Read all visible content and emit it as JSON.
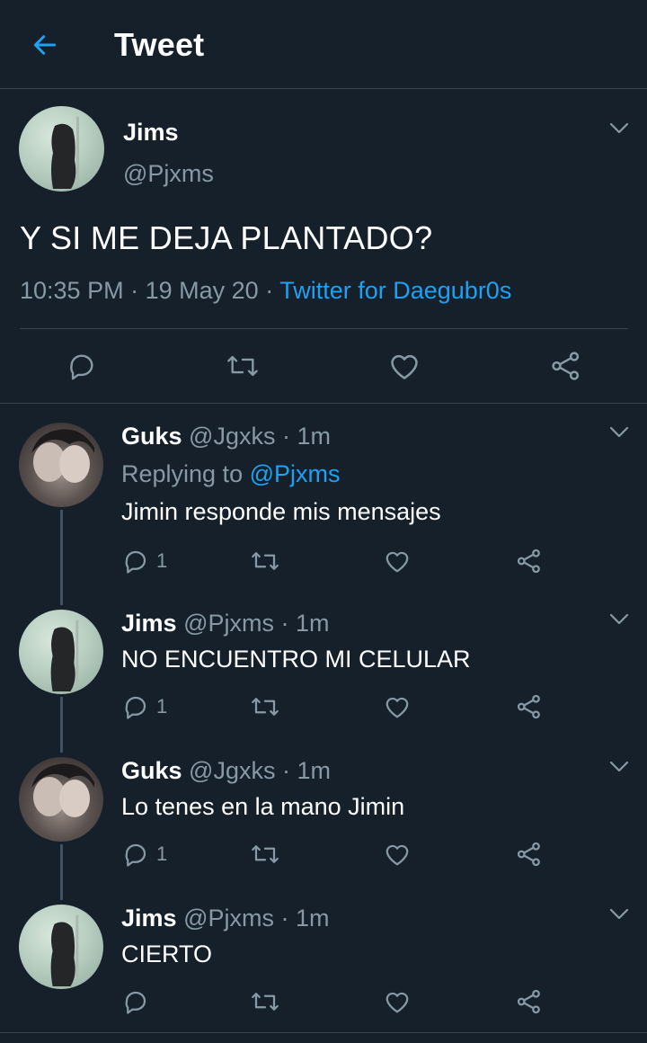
{
  "header": {
    "title": "Tweet"
  },
  "main_tweet": {
    "name": "Jims",
    "handle": "@Pjxms",
    "text": "Y SI ME DEJA PLANTADO?",
    "time": "10:35 PM",
    "date": "19 May 20",
    "source": "Twitter for Daegubr0s"
  },
  "replies": [
    {
      "name": "Guks",
      "handle": "@Jgxks",
      "time": "1m",
      "replying_prefix": "Replying to",
      "replying_to": "@Pjxms",
      "text": "Jimin responde mis mensajes",
      "reply_count": "1"
    },
    {
      "name": "Jims",
      "handle": "@Pjxms",
      "time": "1m",
      "text": "NO ENCUENTRO MI CELULAR",
      "reply_count": "1"
    },
    {
      "name": "Guks",
      "handle": "@Jgxks",
      "time": "1m",
      "text": "Lo tenes en la mano Jimin",
      "reply_count": "1"
    },
    {
      "name": "Jims",
      "handle": "@Pjxms",
      "time": "1m",
      "text": "CIERTO",
      "reply_count": ""
    }
  ],
  "separator": "·",
  "colors": {
    "background": "#15202b",
    "accent": "#1da1f2",
    "secondary_text": "#8899a6",
    "border": "#38444d"
  },
  "icons": {
    "back": "arrow-left-icon",
    "reply": "comment-icon",
    "retweet": "retweet-icon",
    "like": "heart-icon",
    "share": "share-icon",
    "more": "chevron-down-icon"
  }
}
